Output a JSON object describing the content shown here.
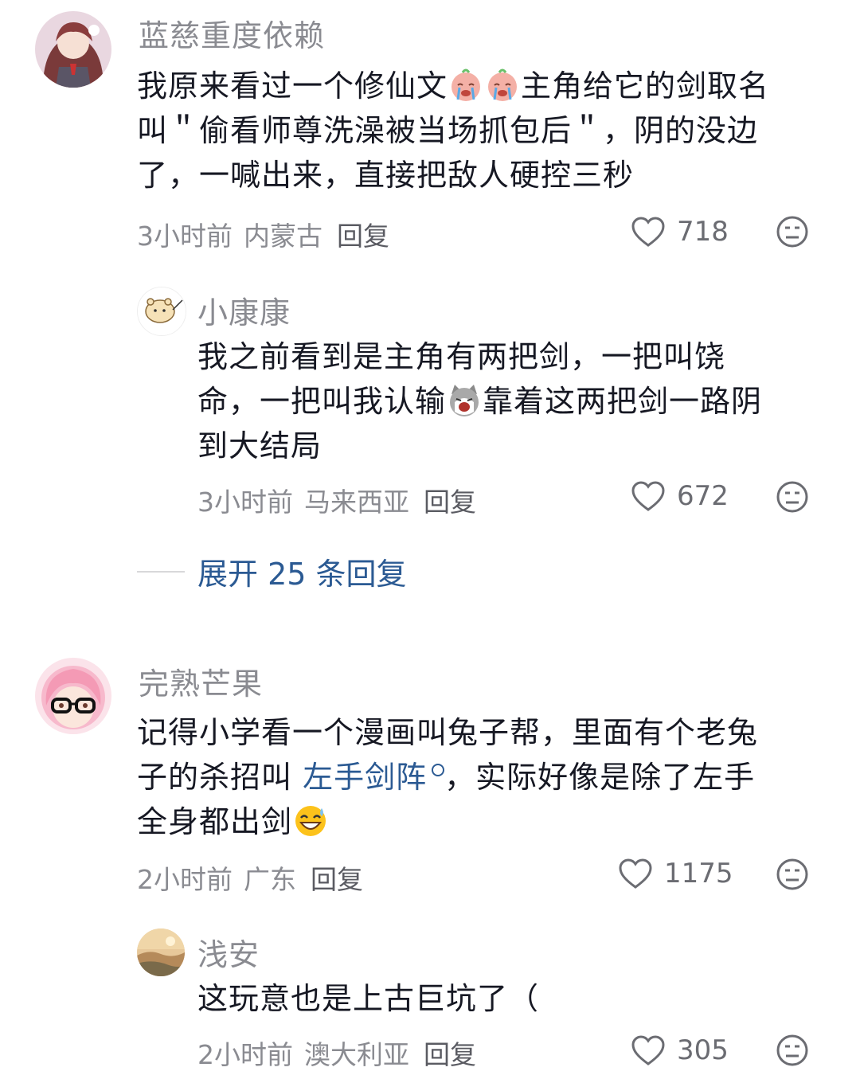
{
  "comments": [
    {
      "username": "蓝慈重度依赖",
      "text_lines": [
        "我原来看过一个修仙文",
        "主角给它的剑取名",
        "叫＂偷看师尊洗澡被当场抓包后＂，阴的没边",
        "了，一喊出来，直接把敌人硬控三秒"
      ],
      "time": "3小时前",
      "location": "内蒙古",
      "reply_label": "回复",
      "likes": "718"
    },
    {
      "username": "小康康",
      "text_lines": [
        "我之前看到是主角有两把剑，一把叫饶",
        "命，一把叫我认输",
        "靠着这两把剑一路阴",
        "到大结局"
      ],
      "time": "3小时前",
      "location": "马来西亚",
      "reply_label": "回复",
      "likes": "672"
    },
    {
      "username": "完熟芒果",
      "text_lines": [
        "记得小学看一个漫画叫兔子帮，里面有个老兔",
        "子的杀招叫",
        "左手剑阵",
        "，实际好像是除了左手",
        "全身都出剑"
      ],
      "time": "2小时前",
      "location": "广东",
      "reply_label": "回复",
      "likes": "1175"
    },
    {
      "username": "浅安",
      "text_lines": [
        "这玩意也是上古巨坑了（"
      ],
      "time": "2小时前",
      "location": "澳大利亚",
      "reply_label": "回复",
      "likes": "305"
    }
  ],
  "expand_replies": "展开 25 条回复",
  "colors": {
    "link": "#2b5a93",
    "meta": "#8a8b91",
    "text": "#161823"
  },
  "icons": [
    "heart-outline-icon",
    "dislike-face-icon",
    "search-icon"
  ]
}
